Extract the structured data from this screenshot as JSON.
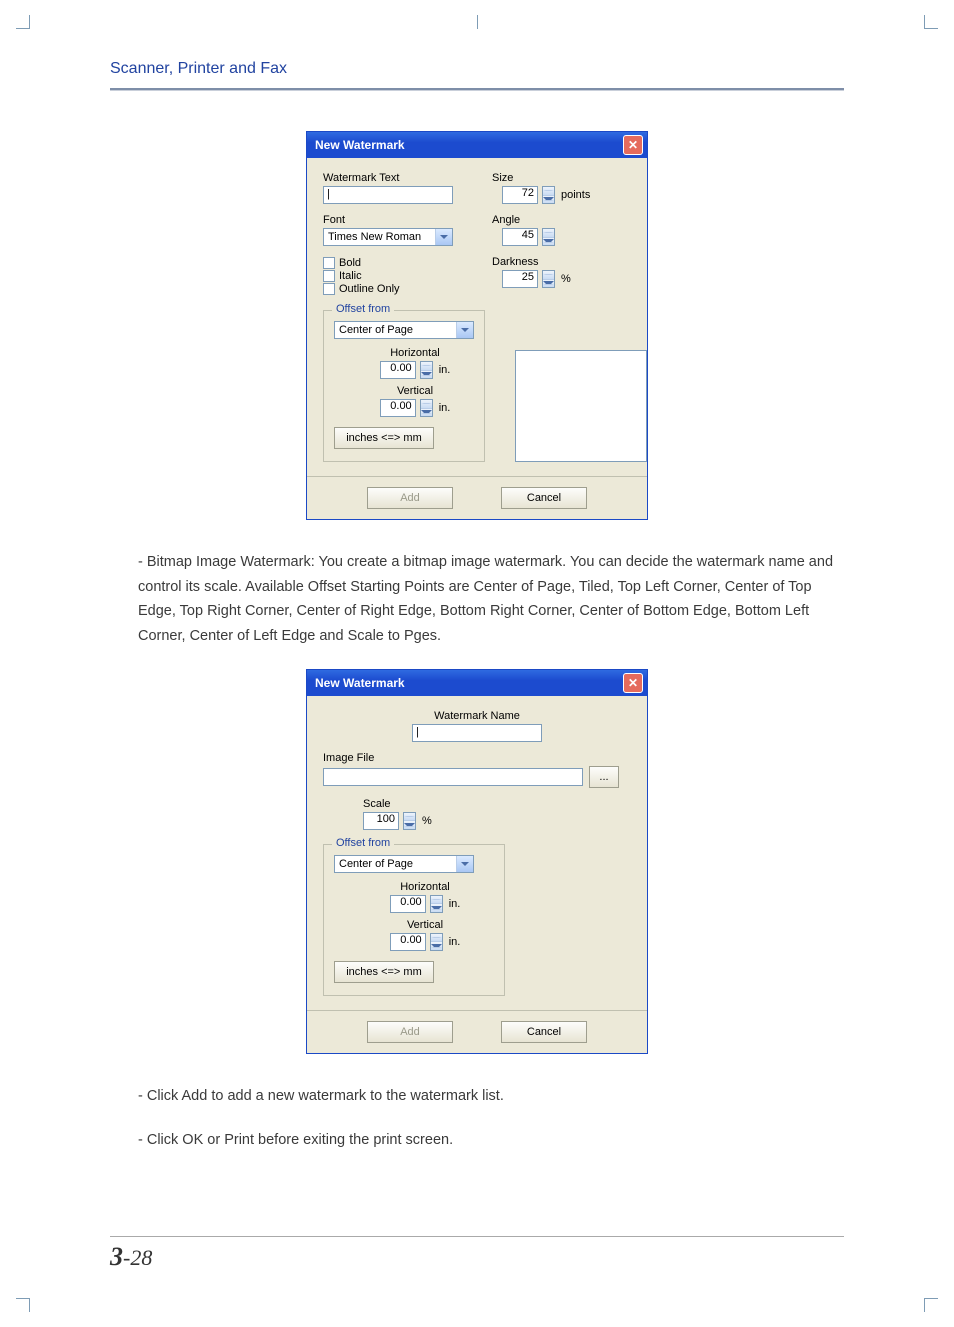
{
  "header": {
    "title": "Scanner, Printer and Fax"
  },
  "dialog1": {
    "title": "New Watermark",
    "watermark_text_label": "Watermark Text",
    "font_label": "Font",
    "font_value": "Times New Roman",
    "bold": "Bold",
    "italic": "Italic",
    "outline_only": "Outline Only",
    "size_label": "Size",
    "size_value": "72",
    "size_unit": "points",
    "angle_label": "Angle",
    "angle_value": "45",
    "darkness_label": "Darkness",
    "darkness_value": "25",
    "darkness_unit": "%",
    "offset_legend": "Offset from",
    "offset_value": "Center of Page",
    "horizontal_label": "Horizontal",
    "horizontal_value": "0.00",
    "vertical_label": "Vertical",
    "vertical_value": "0.00",
    "unit_in": "in.",
    "inches_mm": "inches <=> mm",
    "add": "Add",
    "cancel": "Cancel"
  },
  "para1": "- Bitmap Image Watermark: You create a bitmap image watermark. You can decide the watermark name and control its scale. Available Offset Starting Points are Center of Page, Tiled, Top Left Corner, Center of Top Edge, Top Right Corner, Center of Right Edge, Bottom Right Corner, Center of Bottom Edge, Bottom Left Corner, Center of Left Edge and Scale to Pges.",
  "dialog2": {
    "title": "New Watermark",
    "watermark_name_label": "Watermark Name",
    "image_file_label": "Image File",
    "browse": "...",
    "scale_label": "Scale",
    "scale_value": "100",
    "scale_unit": "%",
    "offset_legend": "Offset from",
    "offset_value": "Center of Page",
    "horizontal_label": "Horizontal",
    "horizontal_value": "0.00",
    "vertical_label": "Vertical",
    "vertical_value": "0.00",
    "unit_in": "in.",
    "inches_mm": "inches <=> mm",
    "add": "Add",
    "cancel": "Cancel"
  },
  "para2": "- Click Add to add a new watermark to the watermark list.",
  "para3": "- Click OK or Print before exiting the print screen.",
  "pagenum": {
    "chapter": "3",
    "sep": "-",
    "page": "28"
  }
}
